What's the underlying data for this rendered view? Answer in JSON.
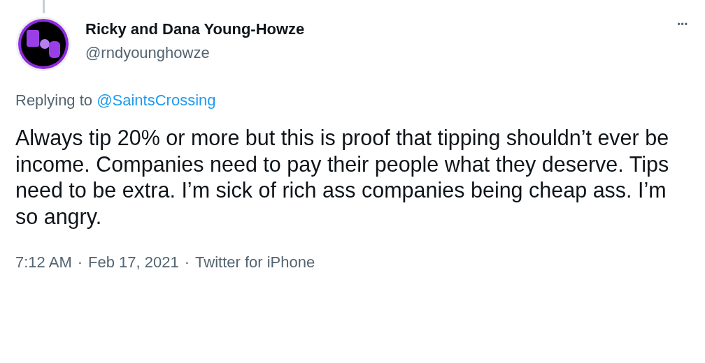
{
  "author": {
    "name": "Ricky and Dana Young-Howze",
    "handle": "@rndyounghowze"
  },
  "menu": {
    "label": "•••"
  },
  "reply_to": {
    "prefix": "Replying to",
    "mention": "@SaintsCrossing"
  },
  "text": "Always tip 20% or more but this is proof that tipping shouldn’t ever be income. Companies need to pay their people what they deserve. Tips need to be extra. I’m sick of rich ass companies being cheap ass. I’m so angry.",
  "meta": [
    {
      "text": "7:12 AM"
    },
    {
      "text": "·"
    },
    {
      "text": "Feb 17, 2021"
    },
    {
      "text": "·"
    },
    {
      "text": "Twitter for iPhone"
    }
  ]
}
